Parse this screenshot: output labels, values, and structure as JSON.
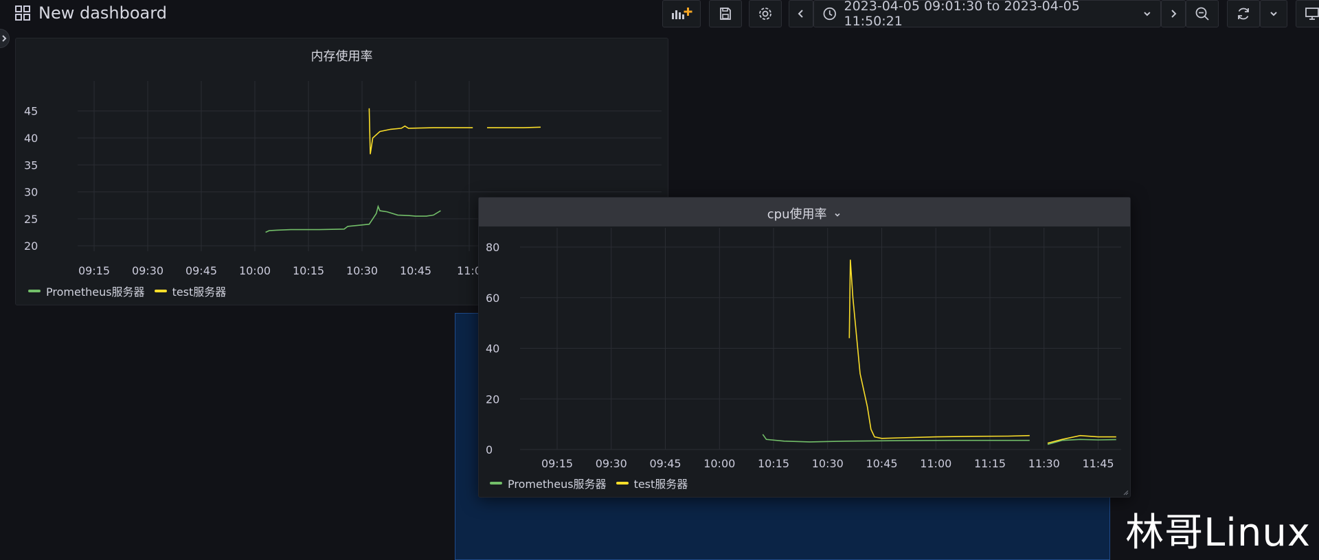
{
  "header": {
    "title": "New dashboard",
    "time_range": "2023-04-05 09:01:30 to 2023-04-05 11:50:21"
  },
  "colors": {
    "green": "#73bf69",
    "yellow": "#fade2a",
    "grid": "#2a2d33"
  },
  "icons": [
    "apps-icon",
    "add-panel-icon",
    "save-icon",
    "gear-icon",
    "chevron-left-icon",
    "clock-icon",
    "chevron-down-icon",
    "chevron-right-icon",
    "zoom-out-icon",
    "refresh-icon",
    "tv-icon"
  ],
  "watermark": "林哥Linux",
  "chart_data": [
    {
      "type": "line",
      "title": "内存使用率",
      "x_ticks": [
        "09:15",
        "09:30",
        "09:45",
        "10:00",
        "10:15",
        "10:30",
        "10:45",
        "11:0"
      ],
      "y_ticks": [
        "45",
        "40",
        "35",
        "30",
        "25",
        "20"
      ],
      "ylim": [
        19,
        47
      ],
      "xlim_min": [
        0,
        115
      ],
      "series": [
        {
          "name": "Prometheus服务器",
          "color": "#73bf69",
          "points": [
            [
              63,
              22.5
            ],
            [
              64,
              22.8
            ],
            [
              66,
              22.9
            ],
            [
              70,
              23
            ],
            [
              78,
              23
            ],
            [
              85,
              23.1
            ],
            [
              86,
              23.6
            ],
            [
              89,
              23.8
            ],
            [
              92,
              24
            ],
            [
              93,
              25
            ],
            [
              94,
              26
            ],
            [
              94.5,
              27.3
            ],
            [
              95,
              26.5
            ],
            [
              97,
              26.3
            ],
            [
              100,
              25.7
            ],
            [
              103,
              25.6
            ],
            [
              105,
              25.5
            ],
            [
              108,
              25.5
            ],
            [
              110,
              25.7
            ],
            [
              112,
              26.5
            ]
          ]
        },
        {
          "name": "test服务器",
          "color": "#fade2a",
          "points": [
            [
              92,
              45.5
            ],
            [
              92.3,
              37
            ],
            [
              93,
              40
            ],
            [
              95,
              41.2
            ],
            [
              98,
              41.6
            ],
            [
              101,
              41.8
            ],
            [
              102,
              42.2
            ],
            [
              103,
              41.8
            ],
            [
              110,
              41.9
            ],
            [
              121,
              41.9
            ]
          ],
          "points2": [
            [
              125,
              41.9
            ],
            [
              135,
              41.9
            ],
            [
              140,
              42
            ]
          ]
        }
      ],
      "grid": true,
      "legend": "bottom-left"
    },
    {
      "type": "line",
      "title": "cpu使用率",
      "x_ticks": [
        "09:15",
        "09:30",
        "09:45",
        "10:00",
        "10:15",
        "10:30",
        "10:45",
        "11:00",
        "11:15",
        "11:30",
        "11:45"
      ],
      "y_ticks": [
        "80",
        "60",
        "40",
        "20",
        "0"
      ],
      "ylim": [
        0,
        80
      ],
      "series": [
        {
          "name": "Prometheus服务器",
          "color": "#73bf69",
          "points": [
            [
              72,
              6
            ],
            [
              73,
              4
            ],
            [
              78,
              3.3
            ],
            [
              85,
              3
            ],
            [
              95,
              3.3
            ],
            [
              110,
              3.5
            ],
            [
              125,
              3.6
            ],
            [
              140,
              3.6
            ],
            [
              146,
              3.6
            ]
          ],
          "points2": [
            [
              151,
              2
            ],
            [
              155,
              3.6
            ],
            [
              160,
              4
            ],
            [
              165,
              3.8
            ],
            [
              170,
              3.9
            ]
          ]
        },
        {
          "name": "test服务器",
          "color": "#fade2a",
          "points": [
            [
              96,
              44
            ],
            [
              96.3,
              75
            ],
            [
              97,
              60
            ],
            [
              99,
              30
            ],
            [
              101,
              17
            ],
            [
              102,
              8
            ],
            [
              103,
              5
            ],
            [
              105,
              4.4
            ],
            [
              110,
              4.6
            ],
            [
              120,
              5
            ],
            [
              130,
              5.2
            ],
            [
              140,
              5.3
            ],
            [
              146,
              5.5
            ]
          ],
          "points2": [
            [
              151,
              2.5
            ],
            [
              155,
              4
            ],
            [
              160,
              5.5
            ],
            [
              165,
              5
            ],
            [
              170,
              5
            ]
          ]
        }
      ],
      "grid": true,
      "legend": "bottom-left"
    }
  ]
}
